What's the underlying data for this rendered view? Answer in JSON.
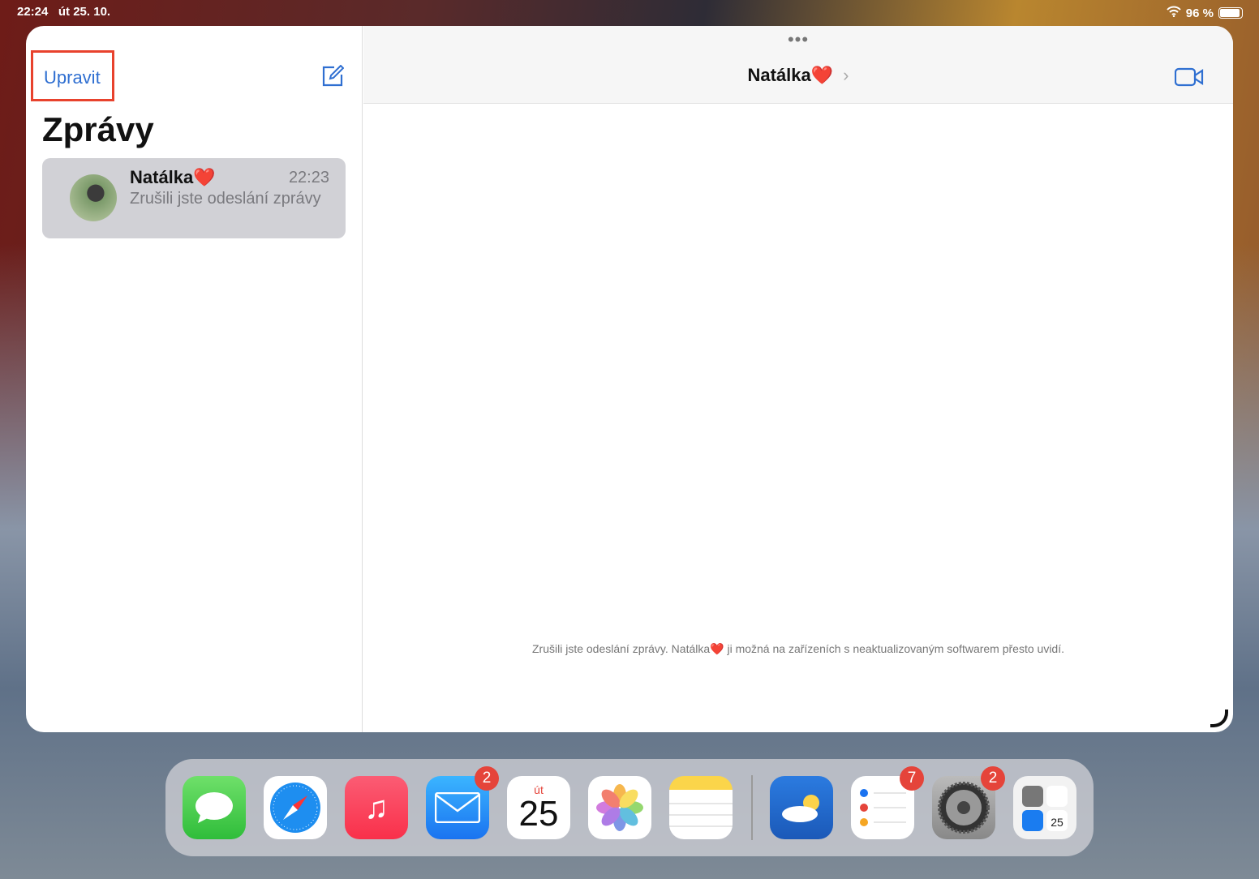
{
  "status_bar": {
    "time": "22:24",
    "date": "út 25. 10.",
    "battery": "96 %",
    "battery_level": 0.96
  },
  "sidebar": {
    "edit_label": "Upravit",
    "title": "Zprávy",
    "conversations": [
      {
        "name": "Natálka❤️",
        "time": "22:23",
        "preview": "Zrušili jste odeslání zprávy"
      }
    ]
  },
  "detail": {
    "menu": "•••",
    "contact": "Natálka❤️",
    "chevron": "›",
    "note": "Zrušili jste odeslání zprávy. Natálka❤️ ji možná na zařízeních s neaktualizovaným softwarem přesto uvidí."
  },
  "dock": {
    "apps": [
      {
        "name": "Zprávy",
        "icon": "messages-icon"
      },
      {
        "name": "Safari",
        "icon": "safari-icon"
      },
      {
        "name": "Hudba",
        "icon": "music-icon"
      },
      {
        "name": "Mail",
        "icon": "mail-icon",
        "badge": "2"
      },
      {
        "name": "Kalendář",
        "icon": "calendar-icon",
        "day": "út",
        "date": "25"
      },
      {
        "name": "Fotky",
        "icon": "photos-icon"
      },
      {
        "name": "Poznámky",
        "icon": "notes-icon"
      },
      {
        "name": "Počasí",
        "icon": "weather-icon"
      },
      {
        "name": "Připomínky",
        "icon": "reminders-icon",
        "badge": "7"
      },
      {
        "name": "Nastavení",
        "icon": "settings-icon",
        "badge": "2"
      },
      {
        "name": "Appky",
        "icon": "app-library-icon",
        "date": "25"
      }
    ]
  }
}
